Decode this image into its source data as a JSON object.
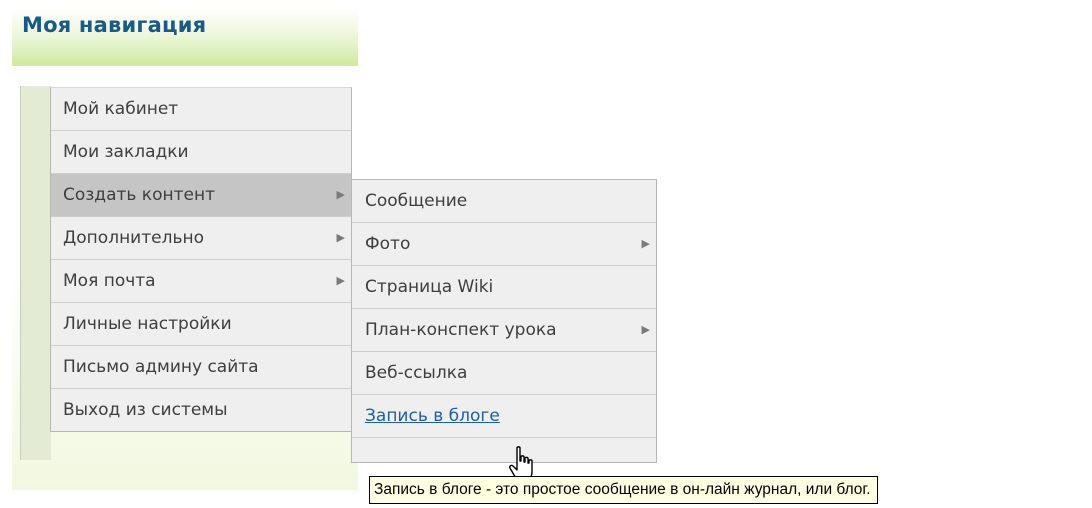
{
  "block": {
    "title": "Моя навигация"
  },
  "menu": {
    "items": [
      {
        "label": "Мой кабинет",
        "has_submenu": false
      },
      {
        "label": "Мои закладки",
        "has_submenu": false
      },
      {
        "label": "Создать контент",
        "has_submenu": true,
        "active": true
      },
      {
        "label": "Дополнительно",
        "has_submenu": true
      },
      {
        "label": "Моя почта",
        "has_submenu": true
      },
      {
        "label": "Личные настройки",
        "has_submenu": false
      },
      {
        "label": "Письмо админу сайта",
        "has_submenu": false
      },
      {
        "label": "Выход из системы",
        "has_submenu": false
      }
    ],
    "arrow_glyph": "▶"
  },
  "submenu": {
    "items": [
      {
        "label": "Сообщение",
        "has_submenu": false
      },
      {
        "label": "Фото",
        "has_submenu": true
      },
      {
        "label": "Страница Wiki",
        "has_submenu": false
      },
      {
        "label": "План-конспект урока",
        "has_submenu": true
      },
      {
        "label": "Веб-ссылка",
        "has_submenu": false
      },
      {
        "label": "Запись в блоге",
        "has_submenu": false,
        "hovered": true
      }
    ]
  },
  "tooltip": {
    "text": "Запись в блоге - это простое сообщение в он-лайн журнал, или блог."
  },
  "colors": {
    "title": "#1a5a86",
    "link": "#1e5ea6",
    "menu_bg": "#efefef",
    "menu_active_bg": "#c5c5c5",
    "tooltip_bg": "#ffffe1"
  }
}
